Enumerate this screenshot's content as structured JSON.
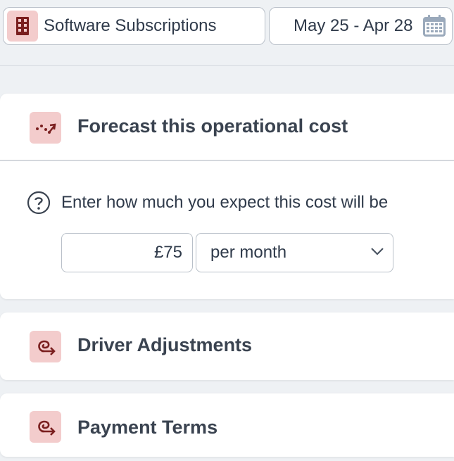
{
  "top_bar": {
    "category": {
      "label": "Software Subscriptions",
      "icon": "building-icon"
    },
    "date_range": {
      "label": "May 25 - Apr 28",
      "icon": "calendar-icon"
    }
  },
  "forecast_card": {
    "title": "Forecast this operational cost",
    "icon": "trend-icon",
    "prompt": "Enter how much you expect this cost will be",
    "amount_value": "£75",
    "period_selected": "per month"
  },
  "driver_card": {
    "title": "Driver Adjustments",
    "icon": "driver-icon"
  },
  "payment_card": {
    "title": "Payment Terms",
    "icon": "payment-icon"
  },
  "colors": {
    "accent": "#7a1f1f",
    "icon_bg": "#f3cccc",
    "text": "#2f3a4a",
    "border": "#b9c0c9",
    "page_bg": "#eef1f4"
  }
}
